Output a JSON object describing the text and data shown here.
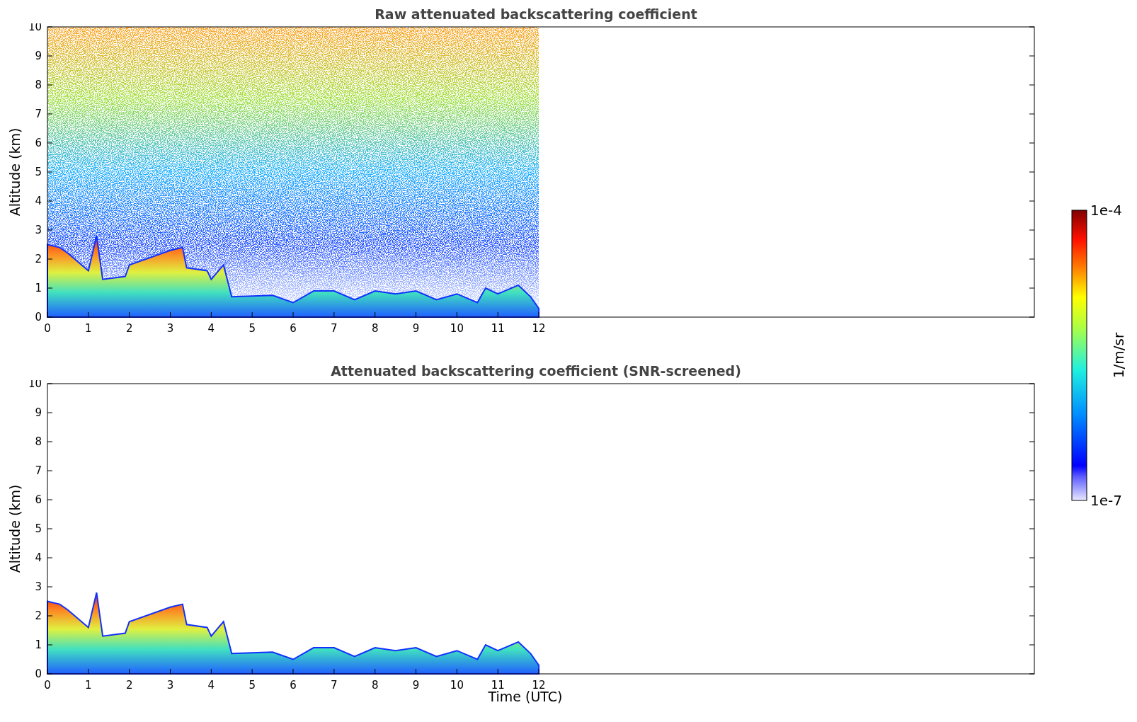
{
  "panels": [
    {
      "title": "Raw attenuated backscattering coefficient",
      "ylabel": "Altitude (km)",
      "kind": "raw",
      "xticks": [
        "0",
        "1",
        "2",
        "3",
        "4",
        "5",
        "6",
        "7",
        "8",
        "9",
        "10",
        "11",
        "12"
      ],
      "yticks": [
        "10",
        "9",
        "8",
        "7",
        "6",
        "5",
        "4",
        "3",
        "2",
        "1",
        "0"
      ]
    },
    {
      "title": "Attenuated backscattering coefficient (SNR-screened)",
      "ylabel": "Altitude (km)",
      "kind": "screened",
      "xticks": [
        "0",
        "1",
        "2",
        "3",
        "4",
        "5",
        "6",
        "7",
        "8",
        "9",
        "10",
        "11",
        "12"
      ],
      "yticks": [
        "10",
        "9",
        "8",
        "7",
        "6",
        "5",
        "4",
        "3",
        "2",
        "1",
        "0"
      ],
      "xlabel": "Time (UTC)"
    }
  ],
  "colorbar": {
    "max": "1e-4",
    "min": "1e-7",
    "label": "1/m/sr"
  }
}
